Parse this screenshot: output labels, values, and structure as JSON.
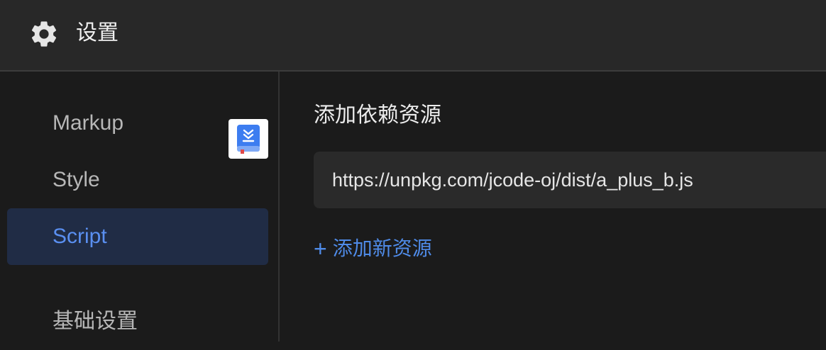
{
  "header": {
    "title": "设置",
    "icon": "gear-icon"
  },
  "sidebar": {
    "items": [
      {
        "label": "Markup",
        "active": false
      },
      {
        "label": "Style",
        "active": false
      },
      {
        "label": "Script",
        "active": true
      },
      {
        "label": "基础设置",
        "active": false
      }
    ]
  },
  "floating_button": {
    "icon": "book-download-icon",
    "accent": "#3d7df0"
  },
  "content": {
    "section_title": "添加依赖资源",
    "resources": [
      "https://unpkg.com/jcode-oj/dist/a_plus_b.js"
    ],
    "add_label": "添加新资源",
    "add_icon": "plus-icon"
  },
  "colors": {
    "accent": "#4f8be8",
    "active_bg": "#202c45",
    "header_bg": "#282828",
    "page_bg": "#1b1b1b"
  }
}
